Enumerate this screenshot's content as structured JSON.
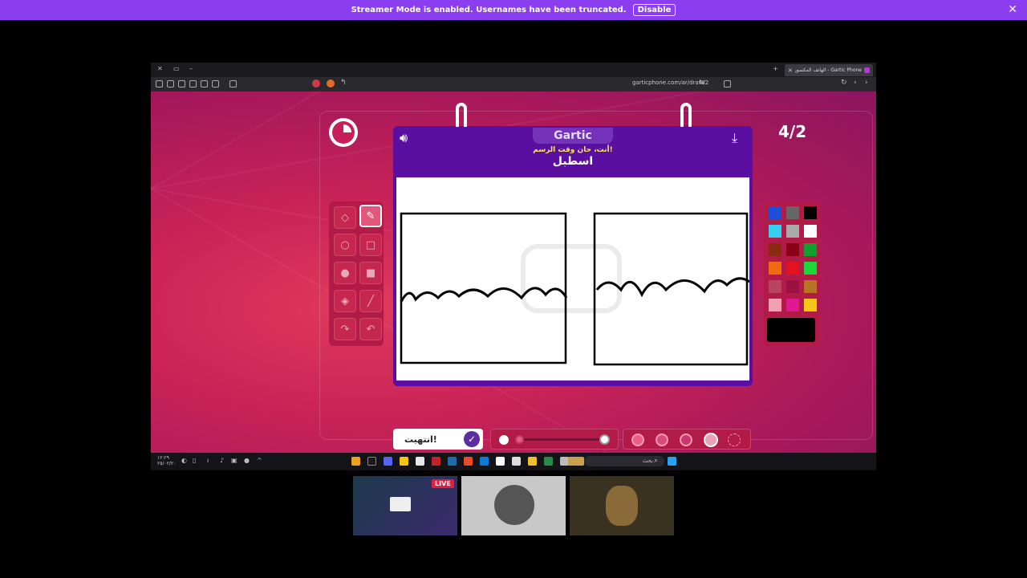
{
  "banner": {
    "text": "Streamer Mode is enabled. Usernames have been truncated.",
    "disable_label": "Disable",
    "close_icon": "close-icon"
  },
  "browser": {
    "tab_title": "Gartic Phone - الهاتف المكسور",
    "url": "garticphone.com/ar/draw/2"
  },
  "game": {
    "round": "4/2",
    "logo": "Gartic",
    "prompt": "أنت، حان وقت الرسم!",
    "word": "اسطبل",
    "done_label": "انتهيت!",
    "tools": [
      "eraser",
      "pencil",
      "circle-outline",
      "square-outline",
      "circle-fill",
      "square-fill",
      "bucket",
      "line",
      "redo",
      "undo"
    ],
    "active_tool": "pencil",
    "palette": [
      "#1c4fd8",
      "#666666",
      "#000000",
      "#35d0f0",
      "#aaaaaa",
      "#ffffff",
      "#8a2a10",
      "#8a0014",
      "#11a030",
      "#ef6a10",
      "#e2121e",
      "#1dd83b",
      "#b84560",
      "#9a1040",
      "#b87422",
      "#f0a0b0",
      "#e01890",
      "#f5c518"
    ],
    "current_color": "#000000",
    "brush_size_percent": 10,
    "opacity_selected": 4
  },
  "taskbar": {
    "search_placeholder": "بحث",
    "date": "١٢:٢٩\n٢٥/٠٢/٢٠"
  },
  "stream": {
    "live_label": "LIVE"
  }
}
